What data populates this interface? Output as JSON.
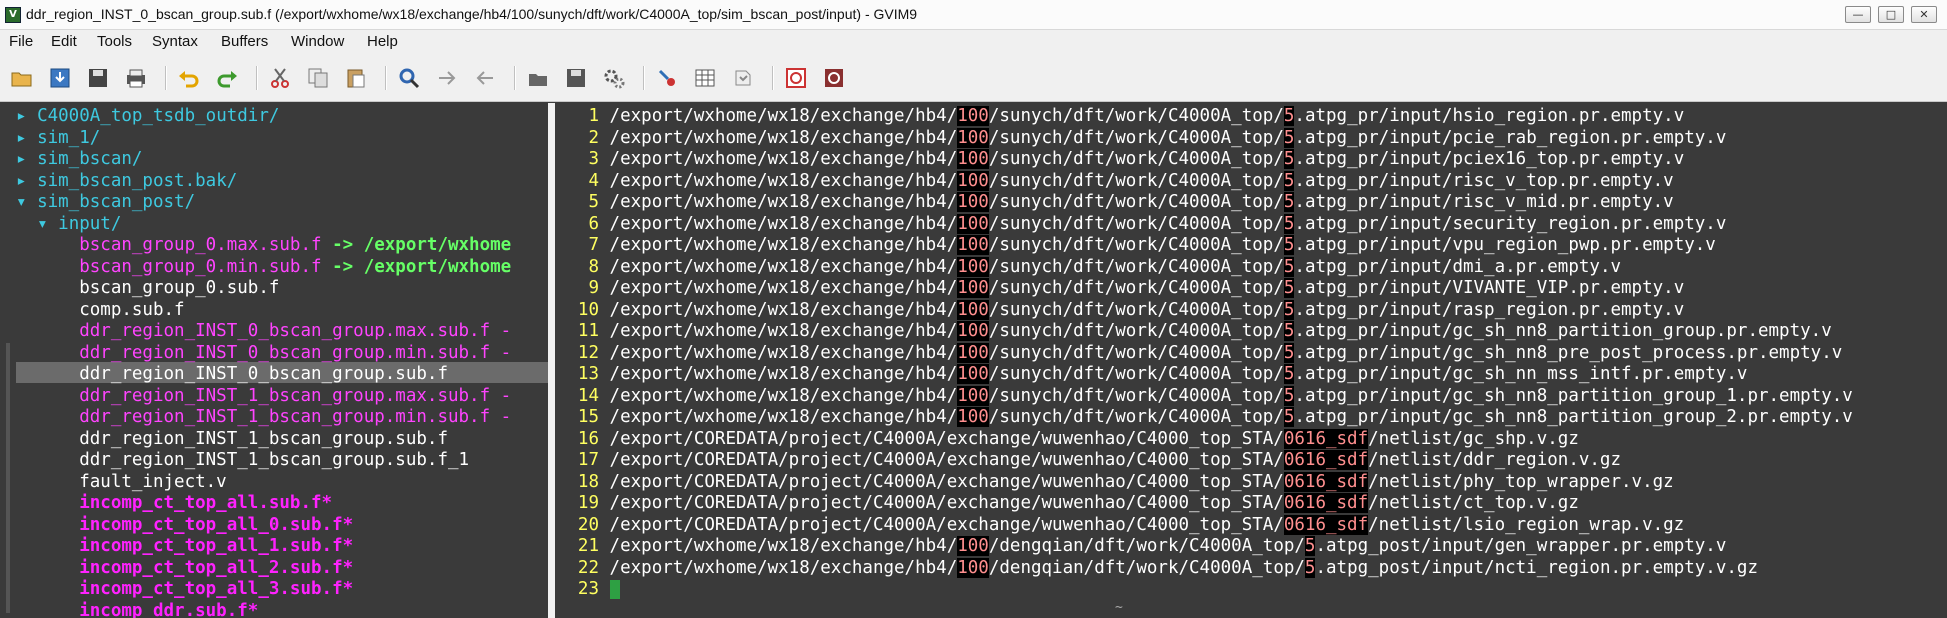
{
  "window": {
    "title": "ddr_region_INST_0_bscan_group.sub.f (/export/wxhome/wx18/exchange/hb4/100/sunych/dft/work/C4000A_top/sim_bscan_post/input) - GVIM9",
    "minimize": "—",
    "maximize": "□",
    "close": "✕"
  },
  "menu": [
    "File",
    "Edit",
    "Tools",
    "Syntax",
    "Buffers",
    "Window",
    "Help"
  ],
  "toolbar": [
    "open-icon",
    "save-download-icon",
    "save-icon",
    "print-icon",
    "undo-icon",
    "redo-icon",
    "cut-icon",
    "copy-icon",
    "paste-icon",
    "find-replace-icon",
    "find-next-icon",
    "find-prev-icon",
    "load-session-icon",
    "save-session-icon",
    "run-script-icon",
    "make-icon",
    "shell-icon",
    "tags-icon",
    "help-icon",
    "find-help-icon"
  ],
  "colors": {
    "dir": "#3ec9e0",
    "symlink": "#ff44ff",
    "symlink_target": "#66ff66",
    "file": "#ffffff",
    "exec": "#ff22ff",
    "line_number": "#ffff60",
    "highlight": "#ff8f8f"
  },
  "tree": [
    {
      "prefix": "▸ ",
      "name": "C4000A_top_tsdb_outdir/",
      "kind": "dir"
    },
    {
      "prefix": "▸ ",
      "name": "sim_1/",
      "kind": "dir"
    },
    {
      "prefix": "▸ ",
      "name": "sim_bscan/",
      "kind": "dir"
    },
    {
      "prefix": "▸ ",
      "name": "sim_bscan_post.bak/",
      "kind": "dir"
    },
    {
      "prefix": "▾ ",
      "name": "sim_bscan_post/",
      "kind": "dir"
    },
    {
      "prefix": "  ▾ ",
      "name": "input/",
      "kind": "dir"
    },
    {
      "prefix": "      ",
      "name": "bscan_group_0.max.sub.f",
      "kind": "symlink",
      "arrow": " -> ",
      "target": "/export/wxhome"
    },
    {
      "prefix": "      ",
      "name": "bscan_group_0.min.sub.f",
      "kind": "symlink",
      "arrow": " -> ",
      "target": "/export/wxhome"
    },
    {
      "prefix": "      ",
      "name": "bscan_group_0.sub.f",
      "kind": "file"
    },
    {
      "prefix": "      ",
      "name": "comp.sub.f",
      "kind": "file"
    },
    {
      "prefix": "      ",
      "name": "ddr_region_INST_0_bscan_group.max.sub.f -",
      "kind": "symlink"
    },
    {
      "prefix": "      ",
      "name": "ddr_region_INST_0_bscan_group.min.sub.f -",
      "kind": "symlink"
    },
    {
      "prefix": "      ",
      "name": "ddr_region_INST_0_bscan_group.sub.f",
      "kind": "selected"
    },
    {
      "prefix": "      ",
      "name": "ddr_region_INST_1_bscan_group.max.sub.f -",
      "kind": "symlink"
    },
    {
      "prefix": "      ",
      "name": "ddr_region_INST_1_bscan_group.min.sub.f -",
      "kind": "symlink"
    },
    {
      "prefix": "      ",
      "name": "ddr_region_INST_1_bscan_group.sub.f",
      "kind": "file"
    },
    {
      "prefix": "      ",
      "name": "ddr_region_INST_1_bscan_group.sub.f_1",
      "kind": "file"
    },
    {
      "prefix": "      ",
      "name": "fault_inject.v",
      "kind": "file"
    },
    {
      "prefix": "      ",
      "name": "incomp_ct_top_all.sub.f*",
      "kind": "exec"
    },
    {
      "prefix": "      ",
      "name": "incomp_ct_top_all_0.sub.f*",
      "kind": "exec"
    },
    {
      "prefix": "      ",
      "name": "incomp_ct_top_all_1.sub.f*",
      "kind": "exec"
    },
    {
      "prefix": "      ",
      "name": "incomp_ct_top_all_2.sub.f*",
      "kind": "exec"
    },
    {
      "prefix": "      ",
      "name": "incomp_ct_top_all_3.sub.f*",
      "kind": "exec"
    },
    {
      "prefix": "      ",
      "name": "incomp_ddr.sub.f*",
      "kind": "exec"
    }
  ],
  "lines": [
    {
      "n": "1",
      "a": "/export/wxhome/wx18/exchange/hb4/",
      "h1": "100",
      "b": "/sunych/dft/work/C4000A_top/",
      "h2": "5",
      "c": ".atpg_pr/input/hsio_region.pr.empty.v"
    },
    {
      "n": "2",
      "a": "/export/wxhome/wx18/exchange/hb4/",
      "h1": "100",
      "b": "/sunych/dft/work/C4000A_top/",
      "h2": "5",
      "c": ".atpg_pr/input/pcie_rab_region.pr.empty.v"
    },
    {
      "n": "3",
      "a": "/export/wxhome/wx18/exchange/hb4/",
      "h1": "100",
      "b": "/sunych/dft/work/C4000A_top/",
      "h2": "5",
      "c": ".atpg_pr/input/pciex16_top.pr.empty.v"
    },
    {
      "n": "4",
      "a": "/export/wxhome/wx18/exchange/hb4/",
      "h1": "100",
      "b": "/sunych/dft/work/C4000A_top/",
      "h2": "5",
      "c": ".atpg_pr/input/risc_v_top.pr.empty.v"
    },
    {
      "n": "5",
      "a": "/export/wxhome/wx18/exchange/hb4/",
      "h1": "100",
      "b": "/sunych/dft/work/C4000A_top/",
      "h2": "5",
      "c": ".atpg_pr/input/risc_v_mid.pr.empty.v"
    },
    {
      "n": "6",
      "a": "/export/wxhome/wx18/exchange/hb4/",
      "h1": "100",
      "b": "/sunych/dft/work/C4000A_top/",
      "h2": "5",
      "c": ".atpg_pr/input/security_region.pr.empty.v"
    },
    {
      "n": "7",
      "a": "/export/wxhome/wx18/exchange/hb4/",
      "h1": "100",
      "b": "/sunych/dft/work/C4000A_top/",
      "h2": "5",
      "c": ".atpg_pr/input/vpu_region_pwp.pr.empty.v"
    },
    {
      "n": "8",
      "a": "/export/wxhome/wx18/exchange/hb4/",
      "h1": "100",
      "b": "/sunych/dft/work/C4000A_top/",
      "h2": "5",
      "c": ".atpg_pr/input/dmi_a.pr.empty.v"
    },
    {
      "n": "9",
      "a": "/export/wxhome/wx18/exchange/hb4/",
      "h1": "100",
      "b": "/sunych/dft/work/C4000A_top/",
      "h2": "5",
      "c": ".atpg_pr/input/VIVANTE_VIP.pr.empty.v"
    },
    {
      "n": "10",
      "a": "/export/wxhome/wx18/exchange/hb4/",
      "h1": "100",
      "b": "/sunych/dft/work/C4000A_top/",
      "h2": "5",
      "c": ".atpg_pr/input/rasp_region.pr.empty.v"
    },
    {
      "n": "11",
      "a": "/export/wxhome/wx18/exchange/hb4/",
      "h1": "100",
      "b": "/sunych/dft/work/C4000A_top/",
      "h2": "5",
      "c": ".atpg_pr/input/gc_sh_nn8_partition_group.pr.empty.v"
    },
    {
      "n": "12",
      "a": "/export/wxhome/wx18/exchange/hb4/",
      "h1": "100",
      "b": "/sunych/dft/work/C4000A_top/",
      "h2": "5",
      "c": ".atpg_pr/input/gc_sh_nn8_pre_post_process.pr.empty.v"
    },
    {
      "n": "13",
      "a": "/export/wxhome/wx18/exchange/hb4/",
      "h1": "100",
      "b": "/sunych/dft/work/C4000A_top/",
      "h2": "5",
      "c": ".atpg_pr/input/gc_sh_nn_mss_intf.pr.empty.v"
    },
    {
      "n": "14",
      "a": "/export/wxhome/wx18/exchange/hb4/",
      "h1": "100",
      "b": "/sunych/dft/work/C4000A_top/",
      "h2": "5",
      "c": ".atpg_pr/input/gc_sh_nn8_partition_group_1.pr.empty.v"
    },
    {
      "n": "15",
      "a": "/export/wxhome/wx18/exchange/hb4/",
      "h1": "100",
      "b": "/sunych/dft/work/C4000A_top/",
      "h2": "5",
      "c": ".atpg_pr/input/gc_sh_nn8_partition_group_2.pr.empty.v"
    },
    {
      "n": "16",
      "a": "/export/COREDATA/project/C4000A/exchange/wuwenhao/C4000_top_STA/",
      "h1": "0616_sdf",
      "b": "/netlist/gc_shp.v.gz",
      "h2": "",
      "c": ""
    },
    {
      "n": "17",
      "a": "/export/COREDATA/project/C4000A/exchange/wuwenhao/C4000_top_STA/",
      "h1": "0616_sdf",
      "b": "/netlist/ddr_region.v.gz",
      "h2": "",
      "c": ""
    },
    {
      "n": "18",
      "a": "/export/COREDATA/project/C4000A/exchange/wuwenhao/C4000_top_STA/",
      "h1": "0616_sdf",
      "b": "/netlist/phy_top_wrapper.v.gz",
      "h2": "",
      "c": ""
    },
    {
      "n": "19",
      "a": "/export/COREDATA/project/C4000A/exchange/wuwenhao/C4000_top_STA/",
      "h1": "0616_sdf",
      "b": "/netlist/ct_top.v.gz",
      "h2": "",
      "c": ""
    },
    {
      "n": "20",
      "a": "/export/COREDATA/project/C4000A/exchange/wuwenhao/C4000_top_STA/",
      "h1": "0616_sdf",
      "b": "/netlist/lsio_region_wrap.v.gz",
      "h2": "",
      "c": ""
    },
    {
      "n": "21",
      "a": "/export/wxhome/wx18/exchange/hb4/",
      "h1": "100",
      "b": "/dengqian/dft/work/C4000A_top/",
      "h2": "5",
      "c": ".atpg_post/input/gen_wrapper.pr.empty.v"
    },
    {
      "n": "22",
      "a": "/export/wxhome/wx18/exchange/hb4/",
      "h1": "100",
      "b": "/dengqian/dft/work/C4000A_top/",
      "h2": "5",
      "c": ".atpg_post/input/ncti_region.pr.empty.v.gz"
    },
    {
      "n": "23",
      "a": "",
      "h1": "",
      "b": "",
      "h2": "",
      "c": ""
    }
  ],
  "cmdline": "~"
}
